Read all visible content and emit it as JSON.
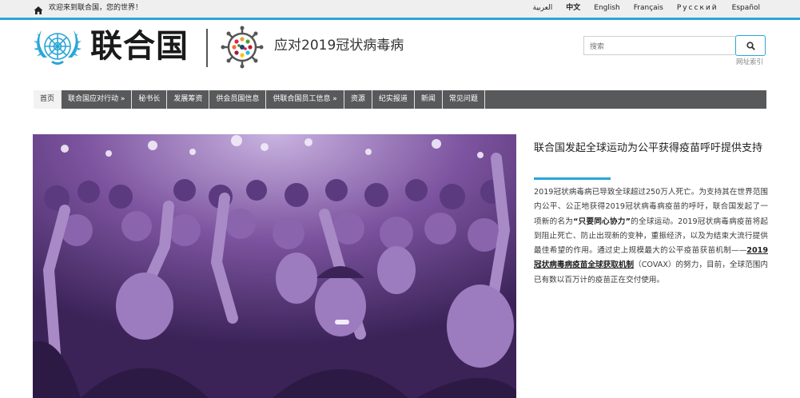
{
  "topbar": {
    "welcome": "欢迎来到联合国，您的世界！",
    "languages": [
      "العربية",
      "中文",
      "English",
      "Français",
      "Русский",
      "Español"
    ],
    "active_language": "中文"
  },
  "header": {
    "un_name": "联合国",
    "covid_title": "应对2019冠状病毒病",
    "search_placeholder": "搜索",
    "sitemap_label": "网址索引"
  },
  "nav": {
    "items": [
      "首页",
      "联合国应对行动 »",
      "秘书长",
      "发展筹资",
      "供会员国信息",
      "供联合国员工信息 »",
      "资源",
      "纪实报道",
      "新闻",
      "常见问题"
    ],
    "active_index": 0
  },
  "article": {
    "title": "联合国发起全球运动为公平获得疫苗呼吁提供支持",
    "body_1": "2019冠状病毒病已导致全球超过250万人死亡。为支持其在世界范围内公平、公正地获得2019冠状病毒病疫苗的呼吁，联合国发起了一项新的名为",
    "highlight": "“只要同心协力”",
    "body_2": "的全球运动。2019冠状病毒病疫苗将起到阻止死亡、防止出现新的变种，重振经济，以及为结束大流行提供最佳希望的作用。通过史上规模最大的公平疫苗获苗机制——",
    "link": "2019冠状病毒病疫苗全球获取机制",
    "body_3": "（COVAX）的努力，目前，全球范围内已有数以百万计的疫苗正在交付使用。"
  },
  "colors": {
    "accent_blue": "#2aa5d8",
    "nav_gray": "#58595b",
    "hero_purple": "#6b3f91"
  }
}
